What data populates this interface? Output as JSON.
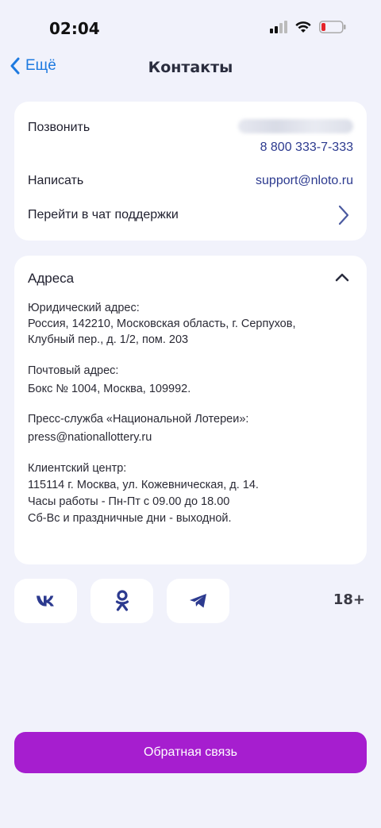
{
  "status": {
    "time": "02:04"
  },
  "nav": {
    "back_label": "Ещё",
    "title": "Контакты"
  },
  "contacts": {
    "call_label": "Позвонить",
    "call_number": "8 800 333-7-333",
    "write_label": "Написать",
    "write_email": "support@nloto.ru",
    "chat_label": "Перейти в чат поддержки"
  },
  "addresses": {
    "title": "Адреса",
    "legal_title": "Юридический адрес:",
    "legal_line1": "Россия, 142210, Московская область, г. Серпухов,",
    "legal_line2": "Клубный пер., д. 1/2, пом. 203",
    "postal_title": "Почтовый адрес:",
    "postal_line1": "Бокс № 1004, Москва, 109992.",
    "press_title": "Пресс-служба «Национальной Лотереи»:",
    "press_line1": "press@nationallottery.ru",
    "client_title": "Клиентский центр:",
    "client_line1": "115114 г. Москва, ул. Кожевническая, д. 14.",
    "client_line2": "Часы работы - Пн-Пт с 09.00 до 18.00",
    "client_line3": "Сб-Вс и праздничные дни - выходной."
  },
  "social": {
    "icons": [
      "vk-icon",
      "odnoklassniki-icon",
      "telegram-icon"
    ]
  },
  "age_rating": "18+",
  "feedback_label": "Обратная связь",
  "colors": {
    "accent": "#a61ecf",
    "link": "#2c3a8f",
    "ios_blue": "#1e7ae0",
    "background": "#f1f2fb"
  }
}
